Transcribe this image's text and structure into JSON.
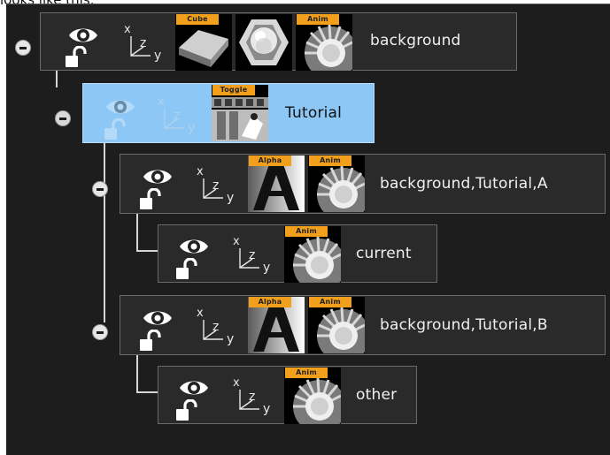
{
  "caption": "looks like this:",
  "colors": {
    "panel_bg": "#1d1d1d",
    "node_bg": "#2a2a2a",
    "selected_bg": "#8cc7f5",
    "plugin_tab": "#f2a01b",
    "tree_line": "#d6d6d6"
  },
  "plugins": {
    "cube": "Cube",
    "toggle": "Toggle",
    "alpha": "Alpha",
    "anim": "Anim"
  },
  "nodes": [
    {
      "id": "background",
      "label": "background",
      "selected": false,
      "expanded": true
    },
    {
      "id": "tutorial",
      "label": "Tutorial",
      "selected": true,
      "expanded": true
    },
    {
      "id": "a",
      "label": "background,Tutorial,A",
      "selected": false,
      "expanded": true
    },
    {
      "id": "current",
      "label": "current",
      "selected": false
    },
    {
      "id": "b",
      "label": "background,Tutorial,B",
      "selected": false,
      "expanded": true
    },
    {
      "id": "other",
      "label": "other",
      "selected": false
    }
  ],
  "icons": {
    "visibility": "eye-icon",
    "lock": "unlocked-padlock-icon",
    "transform": "xyz-axis-icon",
    "collapse": "collapse-minus-icon"
  }
}
